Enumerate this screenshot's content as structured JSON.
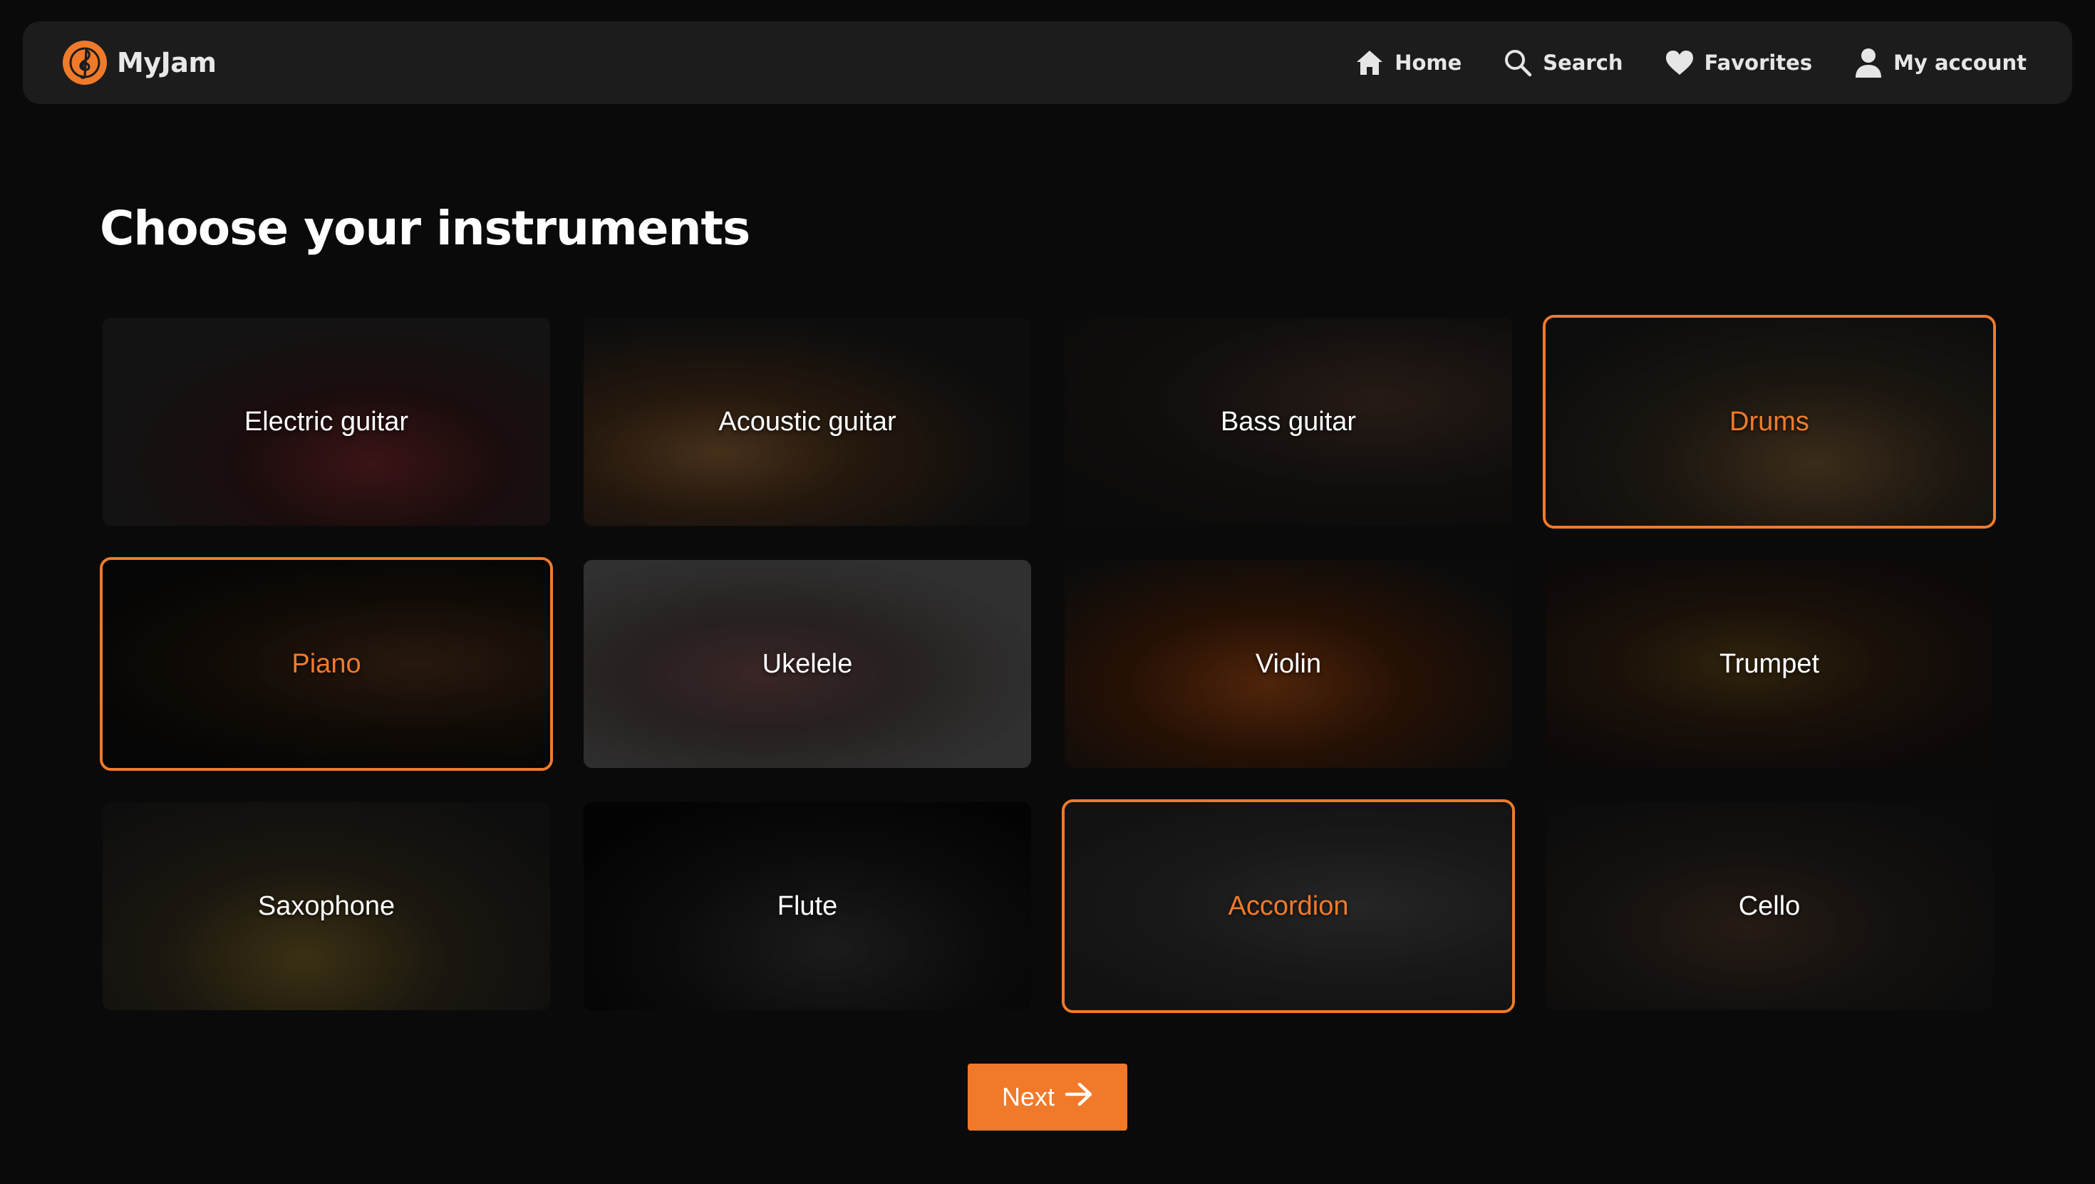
{
  "app": {
    "name": "MyJam",
    "accent_color": "#f07a2a",
    "logo_icon": "treble-clef-icon"
  },
  "nav": {
    "items": [
      {
        "label": "Home",
        "icon": "home-icon"
      },
      {
        "label": "Search",
        "icon": "search-icon"
      },
      {
        "label": "Favorites",
        "icon": "heart-icon"
      },
      {
        "label": "My account",
        "icon": "user-icon"
      }
    ]
  },
  "page": {
    "title": "Choose your instruments"
  },
  "instruments": [
    {
      "label": "Electric guitar",
      "selected": false
    },
    {
      "label": "Acoustic guitar",
      "selected": false
    },
    {
      "label": "Bass guitar",
      "selected": false
    },
    {
      "label": "Drums",
      "selected": true
    },
    {
      "label": "Piano",
      "selected": true
    },
    {
      "label": "Ukelele",
      "selected": false
    },
    {
      "label": "Violin",
      "selected": false
    },
    {
      "label": "Trumpet",
      "selected": false
    },
    {
      "label": "Saxophone",
      "selected": false
    },
    {
      "label": "Flute",
      "selected": false
    },
    {
      "label": "Accordion",
      "selected": true
    },
    {
      "label": "Cello",
      "selected": false
    }
  ],
  "actions": {
    "next_label": "Next",
    "next_icon": "arrow-right-icon"
  }
}
